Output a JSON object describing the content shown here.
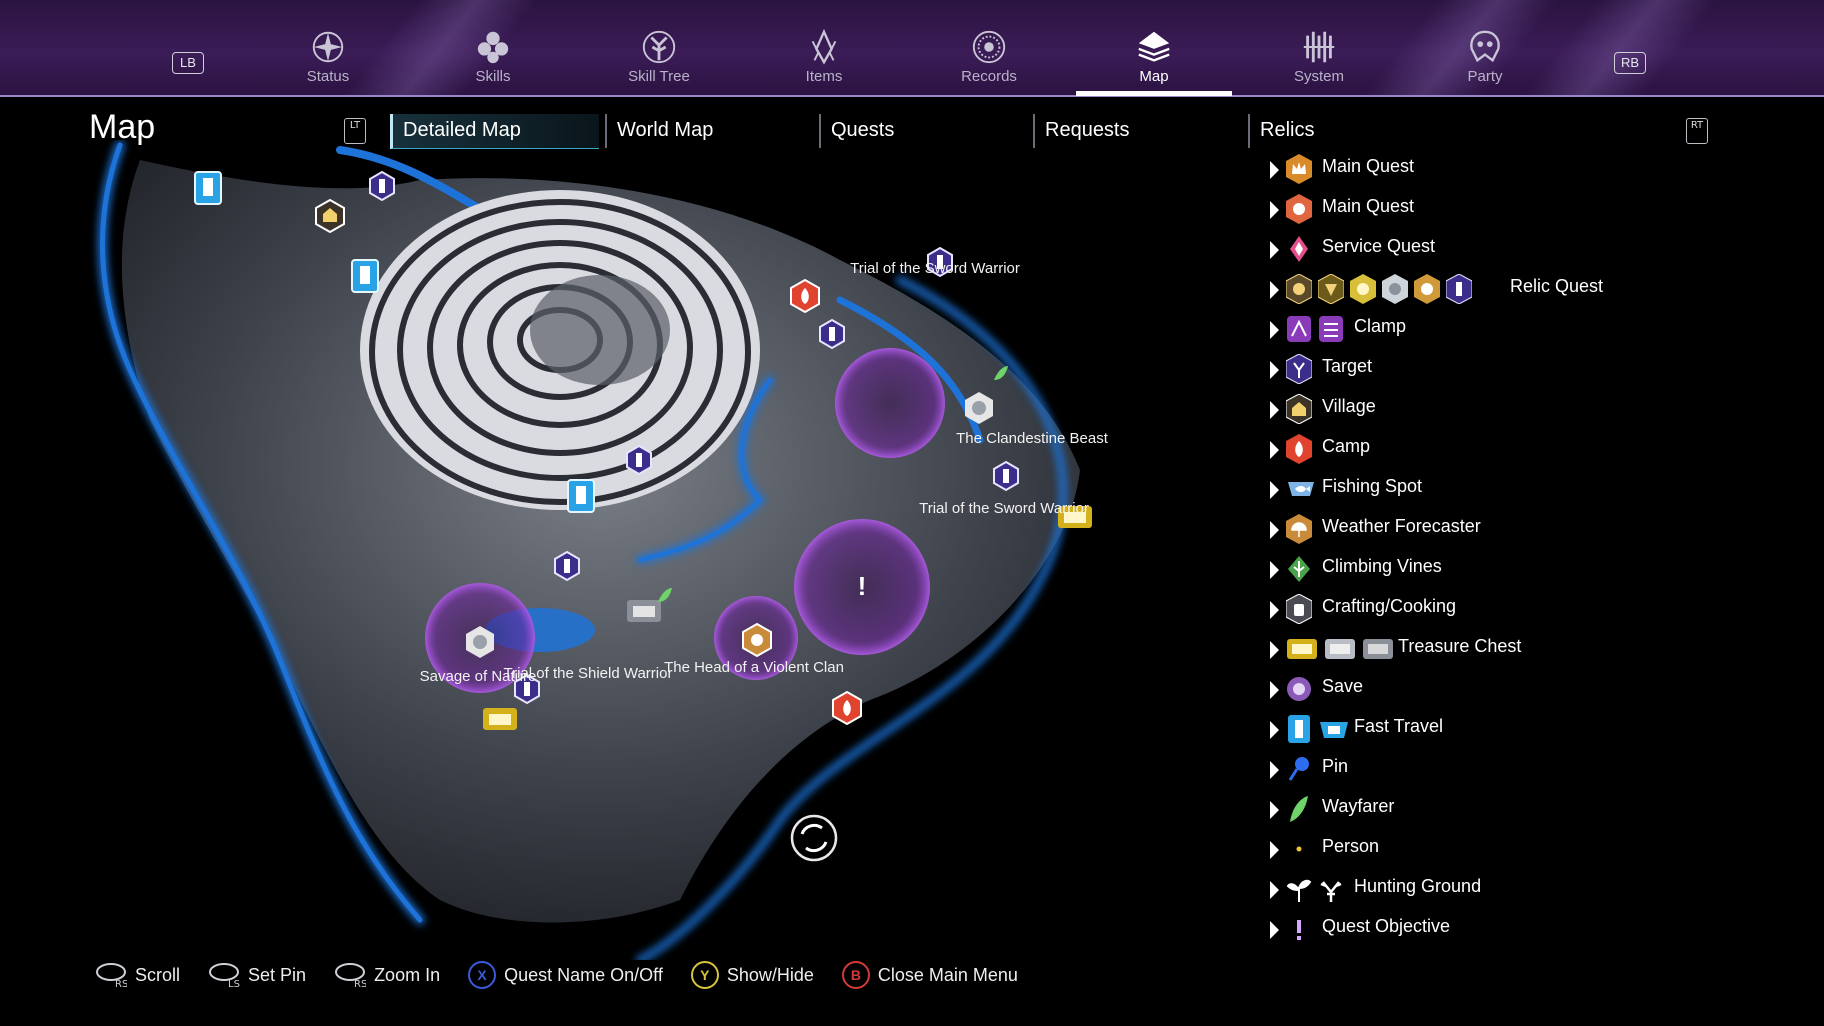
{
  "nav": {
    "left_bumper": "LB",
    "right_bumper": "RB",
    "tabs": [
      {
        "label": "Status",
        "icon": "status-icon"
      },
      {
        "label": "Skills",
        "icon": "skills-icon"
      },
      {
        "label": "Skill Tree",
        "icon": "skill-tree-icon"
      },
      {
        "label": "Items",
        "icon": "items-icon"
      },
      {
        "label": "Records",
        "icon": "records-icon"
      },
      {
        "label": "Map",
        "icon": "map-icon",
        "active": true
      },
      {
        "label": "System",
        "icon": "system-icon"
      },
      {
        "label": "Party",
        "icon": "party-icon"
      }
    ]
  },
  "page": {
    "title": "Map",
    "left_trigger": "LT",
    "right_trigger": "RT",
    "subtabs": [
      {
        "label": "Detailed Map",
        "active": true
      },
      {
        "label": "World Map"
      },
      {
        "label": "Quests"
      },
      {
        "label": "Requests"
      },
      {
        "label": "Relics"
      }
    ]
  },
  "map": {
    "labels": [
      "Trial of the Sword Warrior",
      "The Clandestine Beast",
      "Trial of the Sword Warrior",
      "The Head of a Violent Clan",
      "Savage of Nature",
      "Trial of the Shield Warrior"
    ],
    "objective_mark": "!"
  },
  "legend": [
    {
      "label": "Main Quest",
      "icons": [
        "main-quest-crown-icon"
      ]
    },
    {
      "label": "Main Quest",
      "icons": [
        "main-quest-hand-icon"
      ]
    },
    {
      "label": "Service Quest",
      "icons": [
        "service-quest-icon"
      ]
    },
    {
      "label": "Relic Quest",
      "icons": [
        "relic-quest-icon-1",
        "relic-quest-icon-2",
        "relic-quest-icon-3",
        "relic-quest-icon-4",
        "relic-quest-icon-5",
        "relic-quest-icon-6"
      ]
    },
    {
      "label": "Clamp",
      "icons": [
        "clamp-icon-1",
        "clamp-icon-2"
      ]
    },
    {
      "label": "Target",
      "icons": [
        "target-icon"
      ]
    },
    {
      "label": "Village",
      "icons": [
        "village-icon"
      ]
    },
    {
      "label": "Camp",
      "icons": [
        "camp-icon"
      ]
    },
    {
      "label": "Fishing Spot",
      "icons": [
        "fishing-spot-icon"
      ]
    },
    {
      "label": "Weather Forecaster",
      "icons": [
        "weather-forecaster-icon"
      ]
    },
    {
      "label": "Climbing Vines",
      "icons": [
        "climbing-vines-icon"
      ]
    },
    {
      "label": "Crafting/Cooking",
      "icons": [
        "crafting-cooking-icon"
      ]
    },
    {
      "label": "Treasure Chest",
      "icons": [
        "treasure-chest-gold-icon",
        "treasure-chest-silver-icon",
        "treasure-chest-grey-icon"
      ]
    },
    {
      "label": "Save",
      "icons": [
        "save-icon"
      ]
    },
    {
      "label": "Fast Travel",
      "icons": [
        "fast-travel-icon-1",
        "fast-travel-icon-2"
      ]
    },
    {
      "label": "Pin",
      "icons": [
        "pin-icon"
      ]
    },
    {
      "label": "Wayfarer",
      "icons": [
        "wayfarer-icon"
      ]
    },
    {
      "label": "Person",
      "icons": [
        "person-icon"
      ]
    },
    {
      "label": "Hunting Ground",
      "icons": [
        "hunting-ground-sprout-icon",
        "hunting-ground-antler-icon"
      ]
    },
    {
      "label": "Quest Objective",
      "icons": [
        "quest-objective-icon"
      ]
    }
  ],
  "help": [
    {
      "button": "RS",
      "label": "Scroll"
    },
    {
      "button": "LS",
      "label": "Set Pin"
    },
    {
      "button": "RS",
      "label": "Zoom In"
    },
    {
      "button": "X",
      "label": "Quest Name On/Off",
      "color": "#3b5bd9"
    },
    {
      "button": "Y",
      "label": "Show/Hide",
      "color": "#d6c53a"
    },
    {
      "button": "B",
      "label": "Close Main Menu",
      "color": "#d23a3a"
    }
  ],
  "colors": {
    "nav_bg": "#3b1c57",
    "water": "#1e73d8",
    "quest_zone": "#7a2fb0",
    "relic_quest": "#3b2e8a",
    "camp": "#e0432e",
    "treasure": "#d4b11a"
  }
}
